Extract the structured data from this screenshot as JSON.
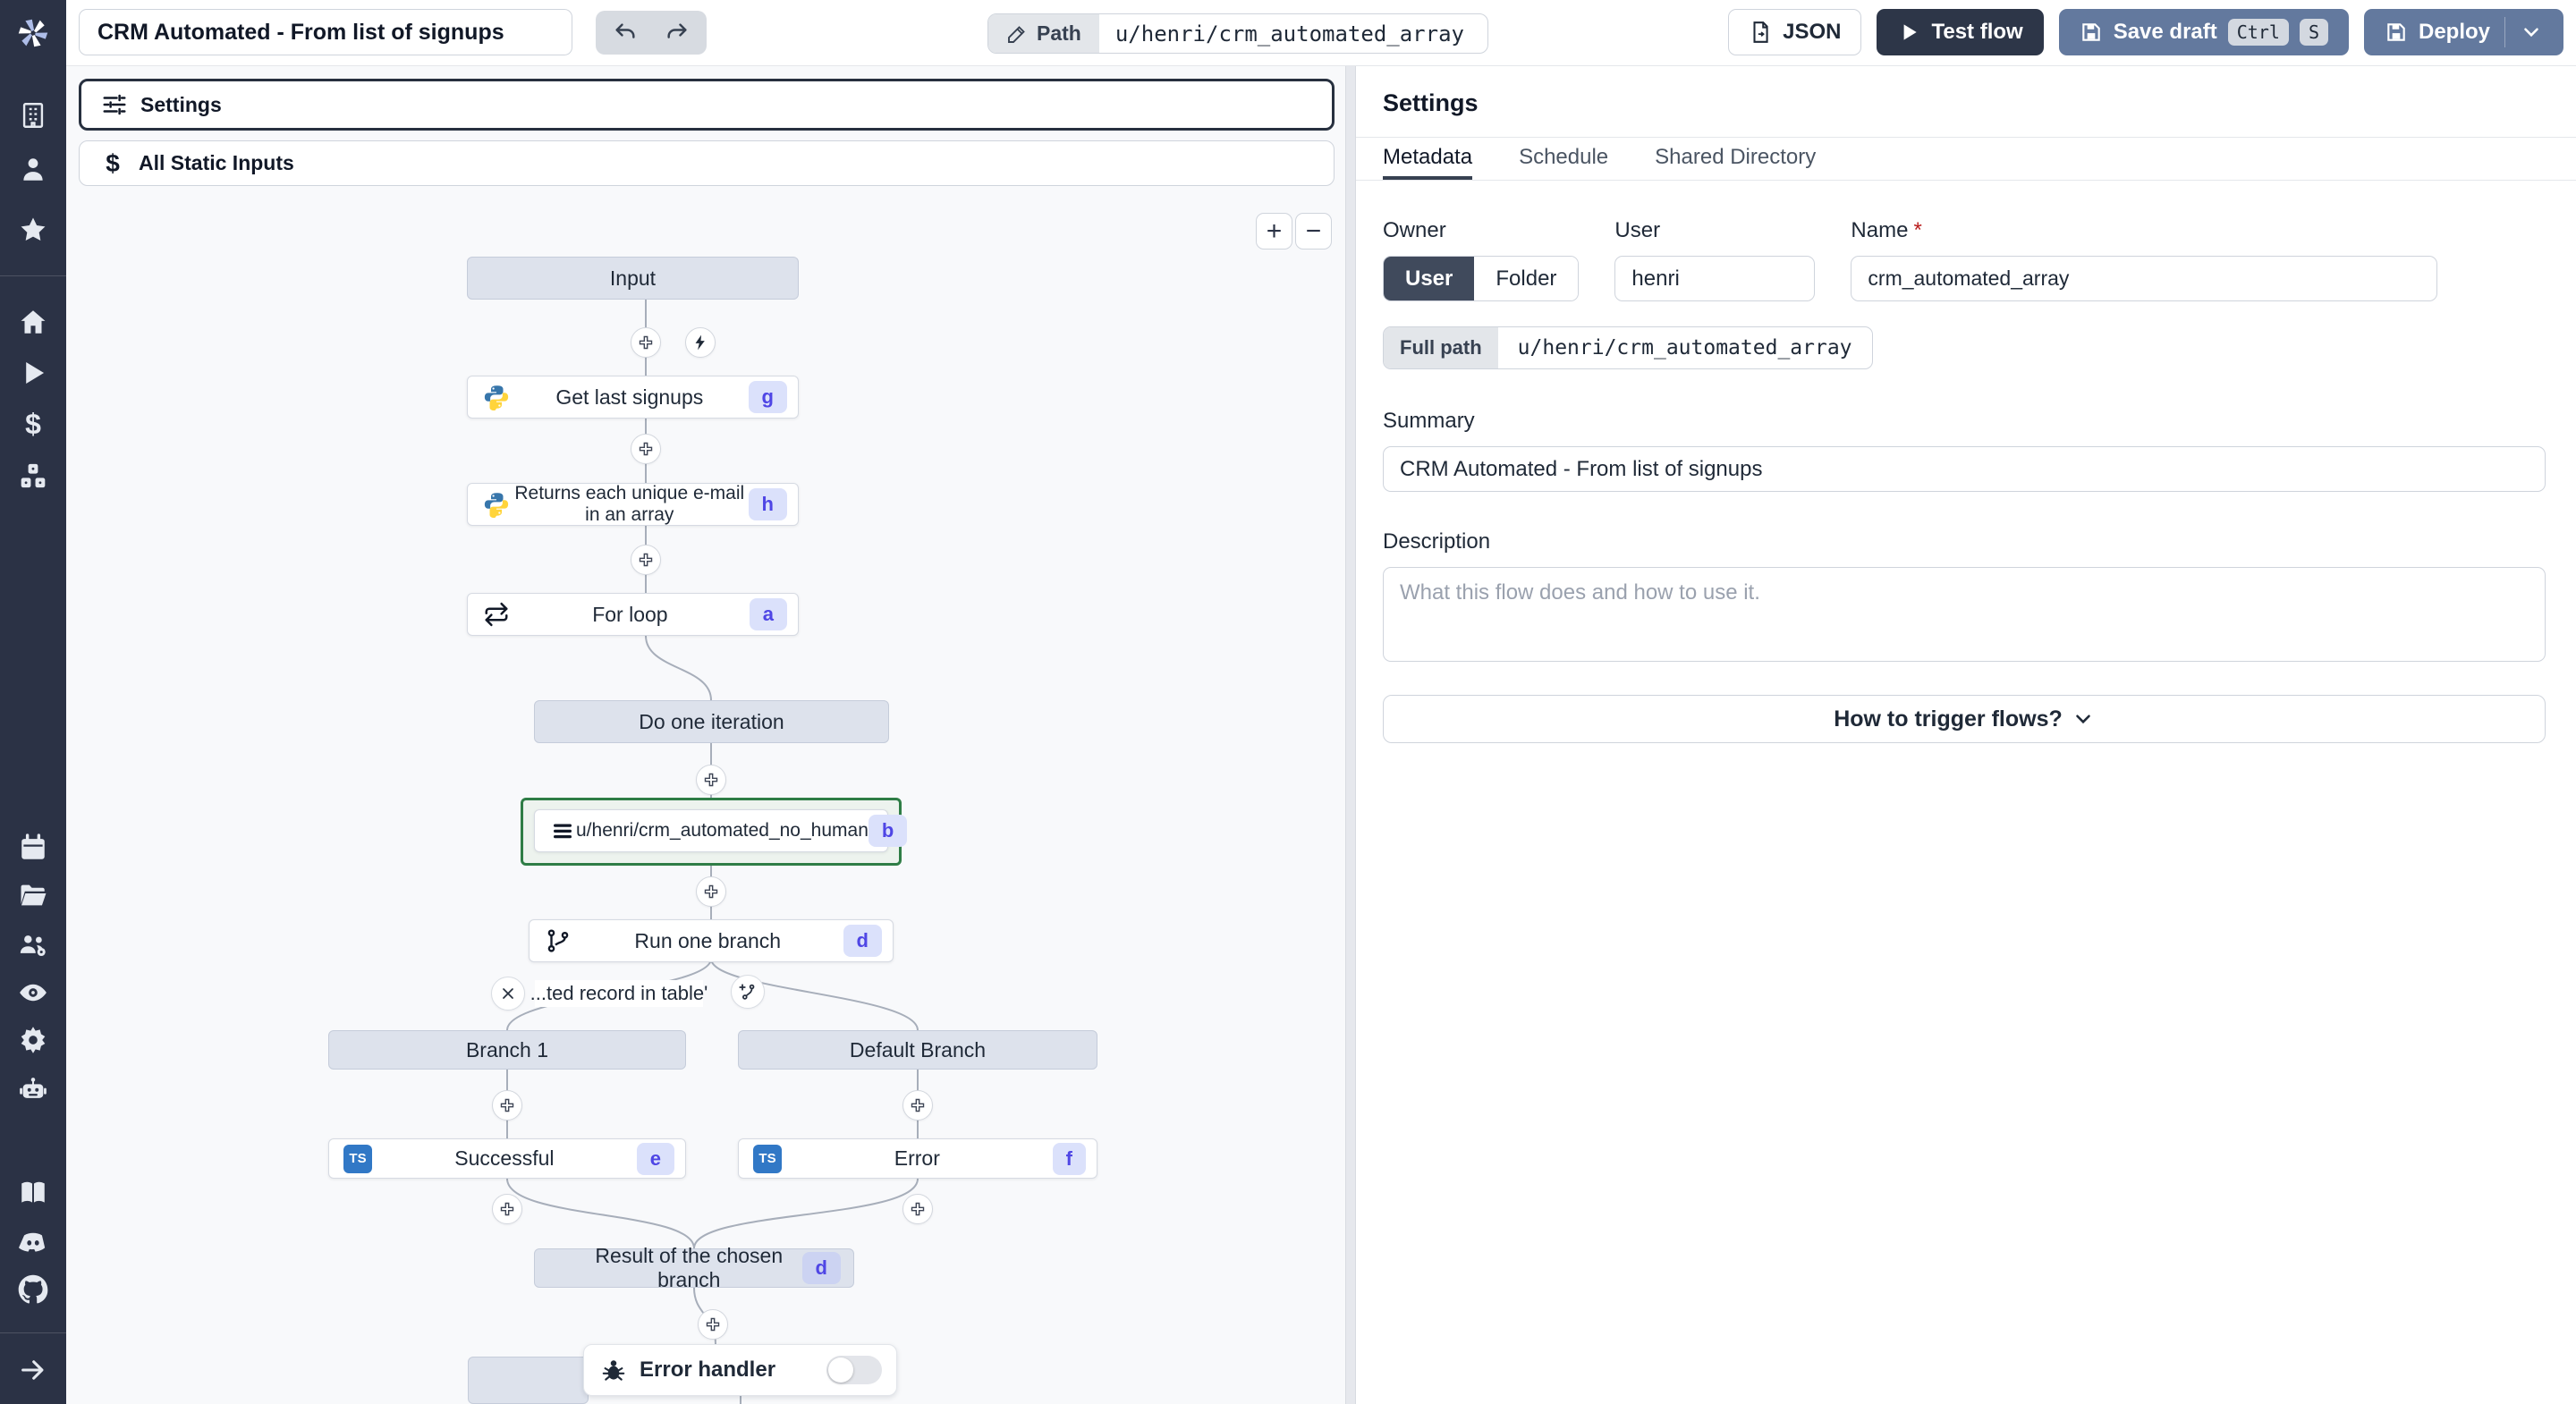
{
  "topbar": {
    "title_value": "CRM Automated - From list of signups",
    "path_label": "Path",
    "path_value": "u/henri/crm_automated_array",
    "json_label": "JSON",
    "test_flow_label": "Test flow",
    "save_draft_label": "Save draft",
    "shortcut_ctrl": "Ctrl",
    "shortcut_s": "S",
    "deploy_label": "Deploy"
  },
  "toolbox": {
    "settings_label": "Settings",
    "static_inputs_label": "All Static Inputs",
    "zoom_in": "+",
    "zoom_out": "−"
  },
  "graph": {
    "input": {
      "label": "Input"
    },
    "get_last_signups": {
      "label": "Get last signups",
      "badge": "g"
    },
    "unique_emails": {
      "label": "Returns each unique e-mail in an array",
      "badge": "h"
    },
    "for_loop": {
      "label": "For loop",
      "badge": "a"
    },
    "do_one_iteration": {
      "label": "Do one iteration"
    },
    "crm_script": {
      "label": "u/henri/crm_automated_no_human",
      "badge": "b"
    },
    "run_one_branch": {
      "label": "Run one branch",
      "badge": "d"
    },
    "condition_label": "...ted record in table'",
    "branch_1": {
      "label": "Branch 1"
    },
    "default_branch": {
      "label": "Default Branch"
    },
    "successful": {
      "label": "Successful",
      "badge": "e"
    },
    "error": {
      "label": "Error",
      "badge": "f"
    },
    "result": {
      "label": "Result of the chosen branch",
      "badge": "d"
    },
    "error_handler": {
      "label": "Error handler"
    }
  },
  "panel": {
    "title": "Settings",
    "tabs": [
      "Metadata",
      "Schedule",
      "Shared Directory"
    ],
    "owner_label": "Owner",
    "owner_user": "User",
    "owner_folder": "Folder",
    "user_label": "User",
    "user_value": "henri",
    "name_label": "Name",
    "name_required_mark": "*",
    "name_value": "crm_automated_array",
    "full_path_label": "Full path",
    "full_path_value": "u/henri/crm_automated_array",
    "summary_label": "Summary",
    "summary_value": "CRM Automated - From list of signups",
    "description_label": "Description",
    "description_placeholder": "What this flow does and how to use it.",
    "trigger_help_label": "How to trigger flows?"
  },
  "icons": {
    "logo": "windmill-pinwheel",
    "plus_circle": "outlined-plus",
    "lightning": "filled-bolt",
    "python": "python-two-tone",
    "typescript": "blue-TS-square",
    "loop": "repeat-arrows",
    "branch": "git-fork",
    "script": "hamburger-lines",
    "bug": "bug-glyph",
    "close": "x-mark",
    "add_branch": "plus-fork"
  },
  "colors": {
    "sidebar_bg": "#2b3245",
    "primary_dark": "#2d3648",
    "action_blue": "#63799e",
    "badge_bg": "#dbe1fb",
    "badge_text": "#4f46e5",
    "selected_green": "#2f7d46",
    "ts_blue": "#3178c6",
    "python_blue": "#3776ab",
    "python_yellow": "#ffd43b",
    "node_gray": "#dde2ec"
  }
}
